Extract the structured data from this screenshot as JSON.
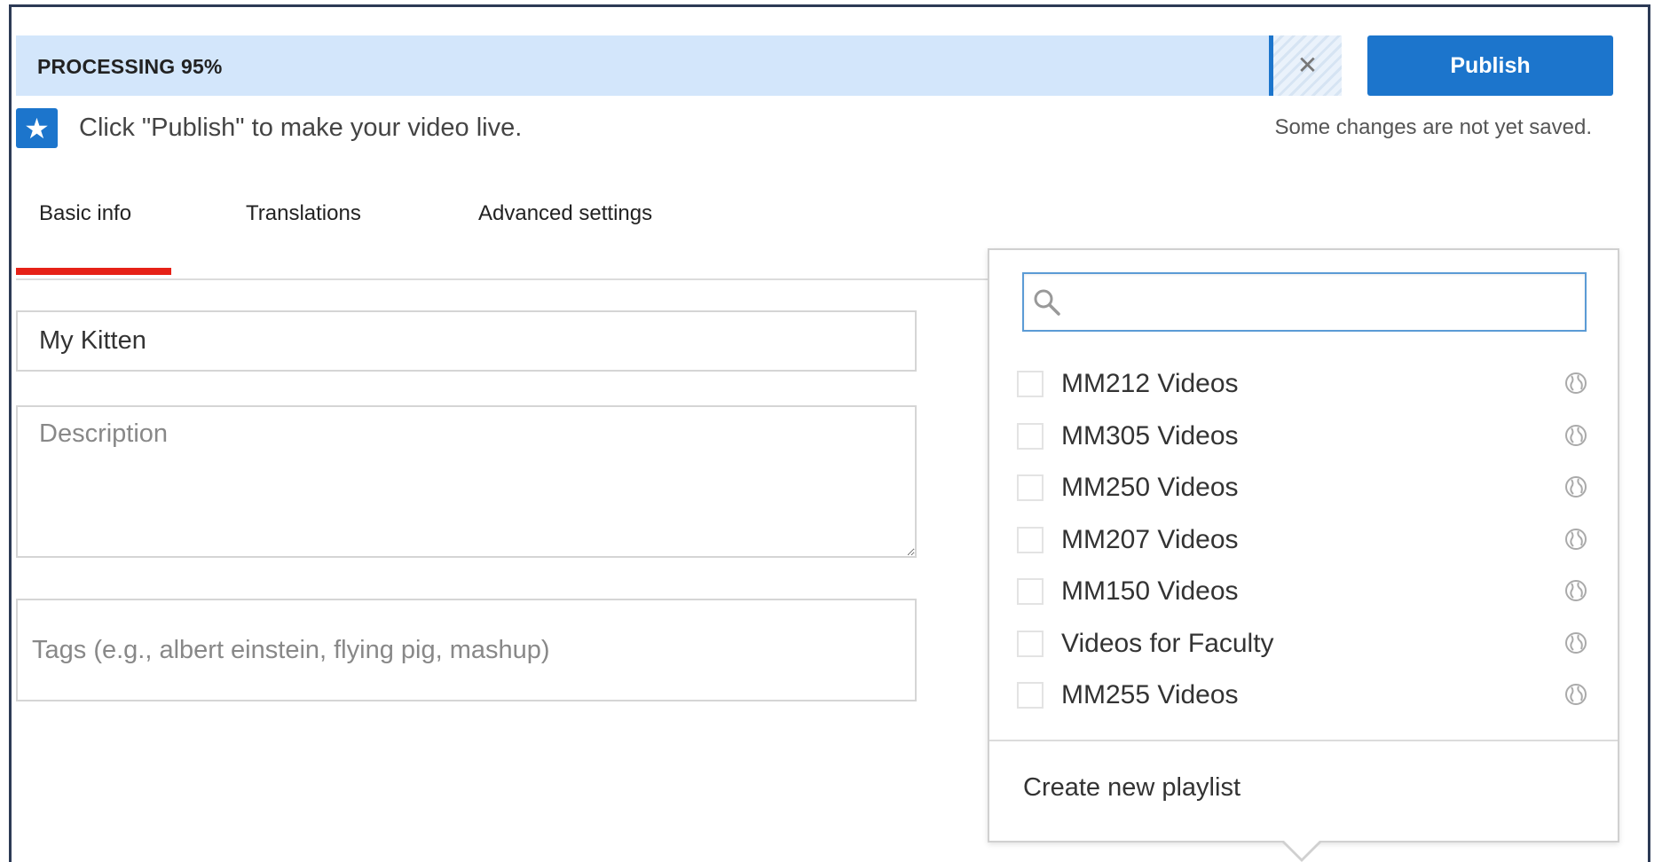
{
  "processing": {
    "label": "PROCESSING 95%",
    "progress_percent": 95,
    "cancel_glyph": "✕",
    "bar_color": "#d3e6fb"
  },
  "publish": {
    "label": "Publish",
    "color": "#1c75cc"
  },
  "hint": {
    "icon": "star-icon",
    "text": "Click \"Publish\" to make your video live."
  },
  "status": {
    "unsaved": "Some changes are not yet saved."
  },
  "tabs": [
    {
      "label": "Basic info",
      "active": true
    },
    {
      "label": "Translations",
      "active": false
    },
    {
      "label": "Advanced settings",
      "active": false
    }
  ],
  "form": {
    "title_value": "My Kitten",
    "description_placeholder": "Description",
    "tags_placeholder": "Tags (e.g., albert einstein, flying pig, mashup)"
  },
  "playlists": {
    "search_placeholder": "",
    "items": [
      {
        "name": "MM212 Videos",
        "checked": false,
        "privacy_icon": "globe-icon"
      },
      {
        "name": "MM305 Videos",
        "checked": false,
        "privacy_icon": "globe-icon"
      },
      {
        "name": "MM250 Videos",
        "checked": false,
        "privacy_icon": "globe-icon"
      },
      {
        "name": "MM207 Videos",
        "checked": false,
        "privacy_icon": "globe-icon"
      },
      {
        "name": "MM150 Videos",
        "checked": false,
        "privacy_icon": "globe-icon"
      },
      {
        "name": "Videos for Faculty",
        "checked": false,
        "privacy_icon": "globe-icon"
      },
      {
        "name": "MM255 Videos",
        "checked": false,
        "privacy_icon": "globe-icon"
      }
    ],
    "create_label": "Create new playlist"
  },
  "colors": {
    "accent_blue": "#1c75cc",
    "tab_active_red": "#e62117"
  }
}
